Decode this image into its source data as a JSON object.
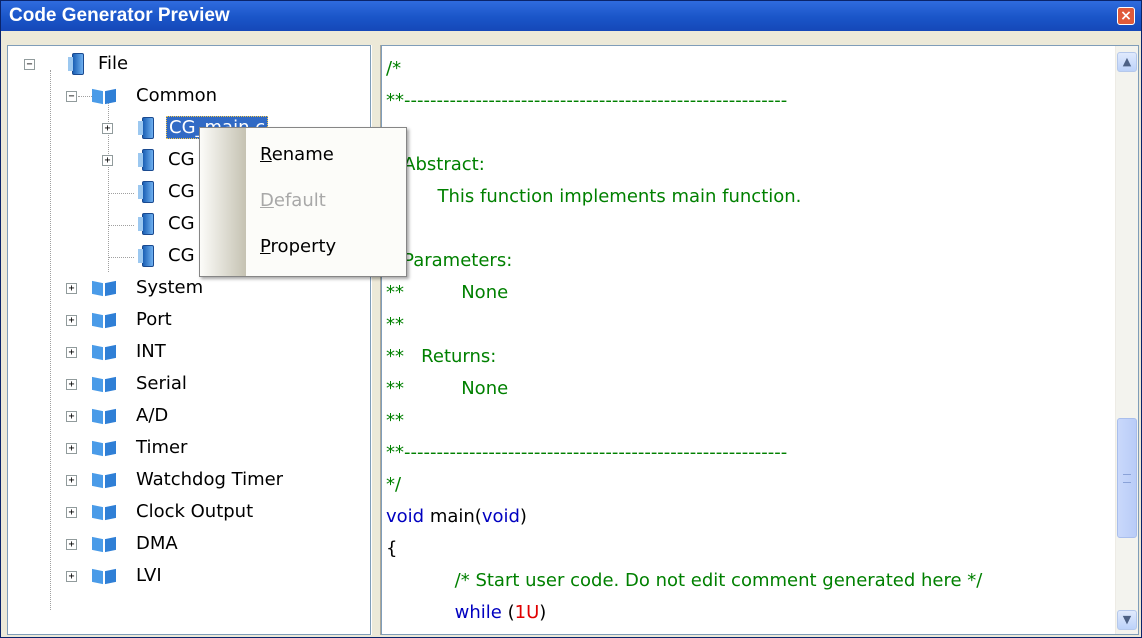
{
  "window": {
    "title": "Code Generator Preview",
    "close_glyph": "×"
  },
  "tree": {
    "root": {
      "label": "File",
      "toggle": "−"
    },
    "common": {
      "label": "Common",
      "toggle": "−"
    },
    "common_children": [
      {
        "label": "CG_main.c",
        "toggle": "+",
        "selected": true
      },
      {
        "label": "CG",
        "toggle": "+"
      },
      {
        "label": "CG",
        "toggle": ""
      },
      {
        "label": "CG",
        "toggle": ""
      },
      {
        "label": "CG",
        "toggle": ""
      }
    ],
    "groups": [
      {
        "label": "System",
        "toggle": "+"
      },
      {
        "label": "Port",
        "toggle": "+"
      },
      {
        "label": "INT",
        "toggle": "+"
      },
      {
        "label": "Serial",
        "toggle": "+"
      },
      {
        "label": "A/D",
        "toggle": "+"
      },
      {
        "label": "Timer",
        "toggle": "+"
      },
      {
        "label": "Watchdog Timer",
        "toggle": "+"
      },
      {
        "label": "Clock Output",
        "toggle": "+"
      },
      {
        "label": "DMA",
        "toggle": "+"
      },
      {
        "label": "LVI",
        "toggle": "+"
      }
    ]
  },
  "context_menu": {
    "items": [
      {
        "accel": "R",
        "rest": "ename",
        "enabled": true
      },
      {
        "accel": "D",
        "rest": "efault",
        "enabled": false
      },
      {
        "accel": "P",
        "rest": "roperty",
        "enabled": true
      }
    ]
  },
  "code": {
    "lines": [
      "/*",
      "**-----------------------------------------------------------",
      "",
      "",
      "   Abstract:",
      "         This function implements main function.",
      "",
      "",
      "   Parameters:",
      "**          None",
      "**",
      "**   Returns:",
      "**          None",
      "**",
      "**-----------------------------------------------------------",
      "*/",
      "void main(void)",
      "{",
      "            /* Start user code. Do not edit comment generated here */",
      "            while (1U)"
    ]
  },
  "scrollbar": {
    "up_glyph": "▲",
    "down_glyph": "▼"
  },
  "colors": {
    "comment": "#008000",
    "keyword": "#0000C0",
    "number": "#E00000",
    "selection": "#316AC5",
    "titlebar": "#1A55C8"
  }
}
